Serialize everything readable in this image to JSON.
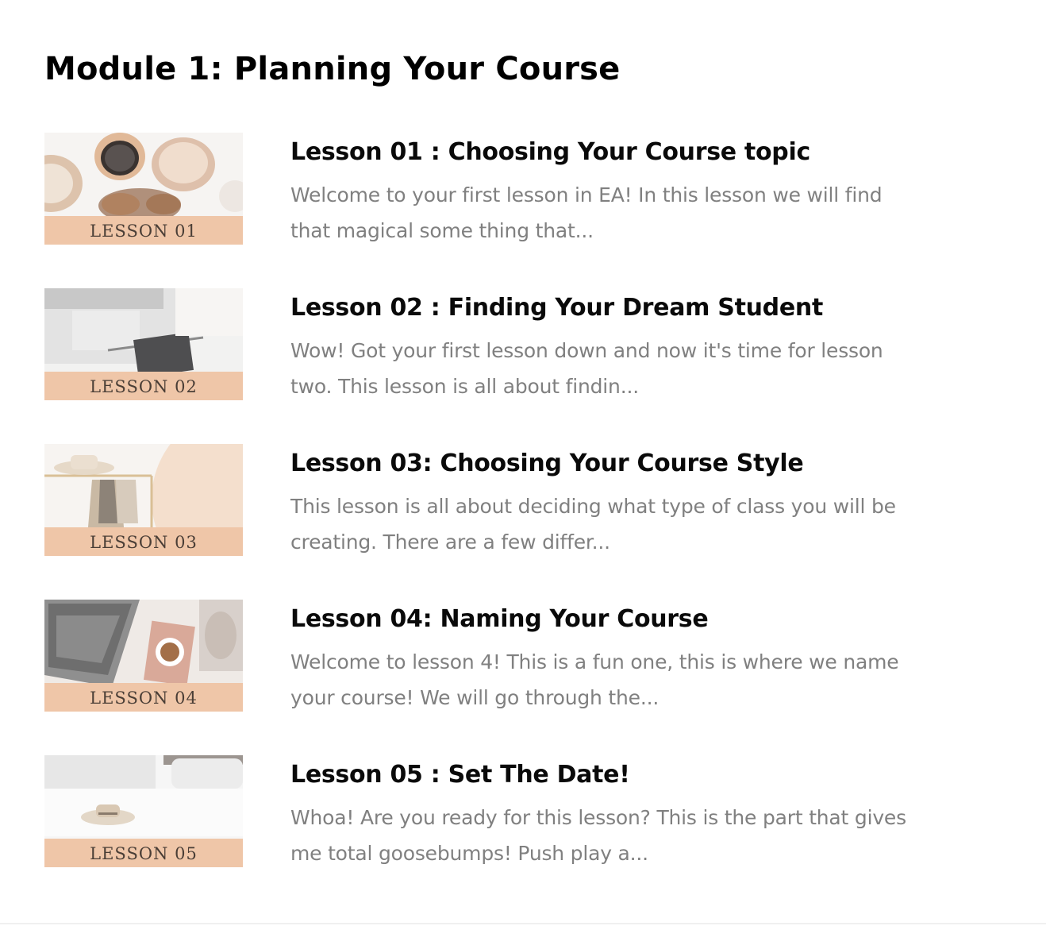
{
  "module": {
    "title": "Module 1: Planning Your Course"
  },
  "lessons": [
    {
      "title": "Lesson 01 : Choosing Your Course topic",
      "description": "Welcome to your first lesson in EA! In this lesson we will find that magical some thing that...",
      "thumb_label": "LESSON 01"
    },
    {
      "title": "Lesson 02 : Finding Your Dream Student",
      "description": "Wow! Got your first lesson down and now it's time for lesson two. This lesson is all about findin...",
      "thumb_label": "LESSON 02"
    },
    {
      "title": "Lesson 03: Choosing Your Course Style",
      "description": "This lesson is all about deciding what type of class you will be creating. There are a few differ...",
      "thumb_label": "LESSON 03"
    },
    {
      "title": "Lesson 04: Naming Your Course",
      "description": "Welcome to lesson 4! This is a fun one, this is where we name your course! We will go through the...",
      "thumb_label": "LESSON 04"
    },
    {
      "title": "Lesson 05 : Set The Date!",
      "description": "Whoa! Are you ready for this lesson? This is the part that gives me total goosebumps! Push play a...",
      "thumb_label": "LESSON 05"
    }
  ],
  "colors": {
    "accent_band": "#efc6a8",
    "title_text": "#0a0a0a",
    "description_text": "#808080"
  }
}
